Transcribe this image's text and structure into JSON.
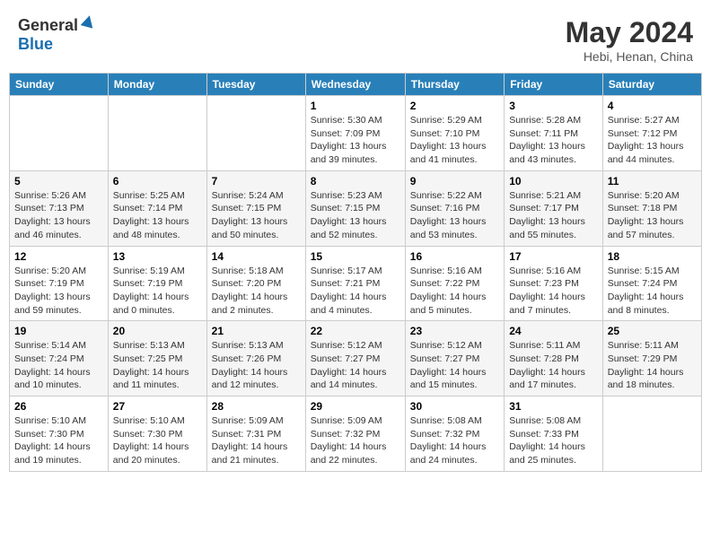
{
  "header": {
    "logo_general": "General",
    "logo_blue": "Blue",
    "title": "May 2024",
    "subtitle": "Hebi, Henan, China"
  },
  "days_of_week": [
    "Sunday",
    "Monday",
    "Tuesday",
    "Wednesday",
    "Thursday",
    "Friday",
    "Saturday"
  ],
  "weeks": [
    [
      {
        "day": "",
        "info": ""
      },
      {
        "day": "",
        "info": ""
      },
      {
        "day": "",
        "info": ""
      },
      {
        "day": "1",
        "info": "Sunrise: 5:30 AM\nSunset: 7:09 PM\nDaylight: 13 hours\nand 39 minutes."
      },
      {
        "day": "2",
        "info": "Sunrise: 5:29 AM\nSunset: 7:10 PM\nDaylight: 13 hours\nand 41 minutes."
      },
      {
        "day": "3",
        "info": "Sunrise: 5:28 AM\nSunset: 7:11 PM\nDaylight: 13 hours\nand 43 minutes."
      },
      {
        "day": "4",
        "info": "Sunrise: 5:27 AM\nSunset: 7:12 PM\nDaylight: 13 hours\nand 44 minutes."
      }
    ],
    [
      {
        "day": "5",
        "info": "Sunrise: 5:26 AM\nSunset: 7:13 PM\nDaylight: 13 hours\nand 46 minutes."
      },
      {
        "day": "6",
        "info": "Sunrise: 5:25 AM\nSunset: 7:14 PM\nDaylight: 13 hours\nand 48 minutes."
      },
      {
        "day": "7",
        "info": "Sunrise: 5:24 AM\nSunset: 7:15 PM\nDaylight: 13 hours\nand 50 minutes."
      },
      {
        "day": "8",
        "info": "Sunrise: 5:23 AM\nSunset: 7:15 PM\nDaylight: 13 hours\nand 52 minutes."
      },
      {
        "day": "9",
        "info": "Sunrise: 5:22 AM\nSunset: 7:16 PM\nDaylight: 13 hours\nand 53 minutes."
      },
      {
        "day": "10",
        "info": "Sunrise: 5:21 AM\nSunset: 7:17 PM\nDaylight: 13 hours\nand 55 minutes."
      },
      {
        "day": "11",
        "info": "Sunrise: 5:20 AM\nSunset: 7:18 PM\nDaylight: 13 hours\nand 57 minutes."
      }
    ],
    [
      {
        "day": "12",
        "info": "Sunrise: 5:20 AM\nSunset: 7:19 PM\nDaylight: 13 hours\nand 59 minutes."
      },
      {
        "day": "13",
        "info": "Sunrise: 5:19 AM\nSunset: 7:19 PM\nDaylight: 14 hours\nand 0 minutes."
      },
      {
        "day": "14",
        "info": "Sunrise: 5:18 AM\nSunset: 7:20 PM\nDaylight: 14 hours\nand 2 minutes."
      },
      {
        "day": "15",
        "info": "Sunrise: 5:17 AM\nSunset: 7:21 PM\nDaylight: 14 hours\nand 4 minutes."
      },
      {
        "day": "16",
        "info": "Sunrise: 5:16 AM\nSunset: 7:22 PM\nDaylight: 14 hours\nand 5 minutes."
      },
      {
        "day": "17",
        "info": "Sunrise: 5:16 AM\nSunset: 7:23 PM\nDaylight: 14 hours\nand 7 minutes."
      },
      {
        "day": "18",
        "info": "Sunrise: 5:15 AM\nSunset: 7:24 PM\nDaylight: 14 hours\nand 8 minutes."
      }
    ],
    [
      {
        "day": "19",
        "info": "Sunrise: 5:14 AM\nSunset: 7:24 PM\nDaylight: 14 hours\nand 10 minutes."
      },
      {
        "day": "20",
        "info": "Sunrise: 5:13 AM\nSunset: 7:25 PM\nDaylight: 14 hours\nand 11 minutes."
      },
      {
        "day": "21",
        "info": "Sunrise: 5:13 AM\nSunset: 7:26 PM\nDaylight: 14 hours\nand 12 minutes."
      },
      {
        "day": "22",
        "info": "Sunrise: 5:12 AM\nSunset: 7:27 PM\nDaylight: 14 hours\nand 14 minutes."
      },
      {
        "day": "23",
        "info": "Sunrise: 5:12 AM\nSunset: 7:27 PM\nDaylight: 14 hours\nand 15 minutes."
      },
      {
        "day": "24",
        "info": "Sunrise: 5:11 AM\nSunset: 7:28 PM\nDaylight: 14 hours\nand 17 minutes."
      },
      {
        "day": "25",
        "info": "Sunrise: 5:11 AM\nSunset: 7:29 PM\nDaylight: 14 hours\nand 18 minutes."
      }
    ],
    [
      {
        "day": "26",
        "info": "Sunrise: 5:10 AM\nSunset: 7:30 PM\nDaylight: 14 hours\nand 19 minutes."
      },
      {
        "day": "27",
        "info": "Sunrise: 5:10 AM\nSunset: 7:30 PM\nDaylight: 14 hours\nand 20 minutes."
      },
      {
        "day": "28",
        "info": "Sunrise: 5:09 AM\nSunset: 7:31 PM\nDaylight: 14 hours\nand 21 minutes."
      },
      {
        "day": "29",
        "info": "Sunrise: 5:09 AM\nSunset: 7:32 PM\nDaylight: 14 hours\nand 22 minutes."
      },
      {
        "day": "30",
        "info": "Sunrise: 5:08 AM\nSunset: 7:32 PM\nDaylight: 14 hours\nand 24 minutes."
      },
      {
        "day": "31",
        "info": "Sunrise: 5:08 AM\nSunset: 7:33 PM\nDaylight: 14 hours\nand 25 minutes."
      },
      {
        "day": "",
        "info": ""
      }
    ]
  ]
}
